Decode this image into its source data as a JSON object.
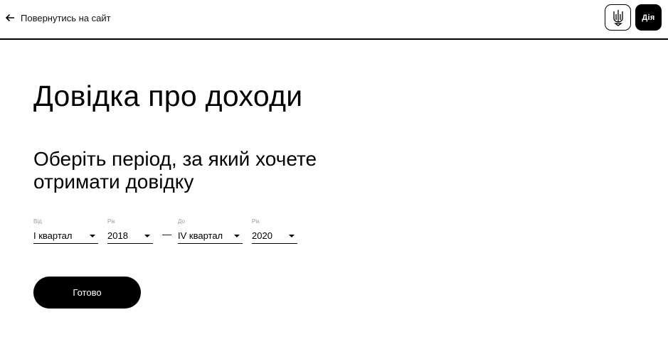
{
  "header": {
    "back_label": "Повернутись на сайт",
    "logo_diia_text": "Дія"
  },
  "main": {
    "title": "Довідка про доходи",
    "subtitle": "Оберіть період, за який хочете отримати довідку",
    "period": {
      "from_quarter": {
        "label": "Від",
        "value": "I квартал"
      },
      "from_year": {
        "label": "Рік",
        "value": "2018"
      },
      "separator": "—",
      "to_quarter": {
        "label": "До",
        "value": "IV квартал"
      },
      "to_year": {
        "label": "Рік",
        "value": "2020"
      }
    },
    "submit_label": "Готово"
  },
  "icons": {
    "back": "arrow-left-icon",
    "emblem": "trident-icon",
    "dropdown": "caret-down-icon"
  },
  "colors": {
    "primary": "#000000",
    "background": "#ffffff",
    "field_label": "#9a9a9a"
  }
}
